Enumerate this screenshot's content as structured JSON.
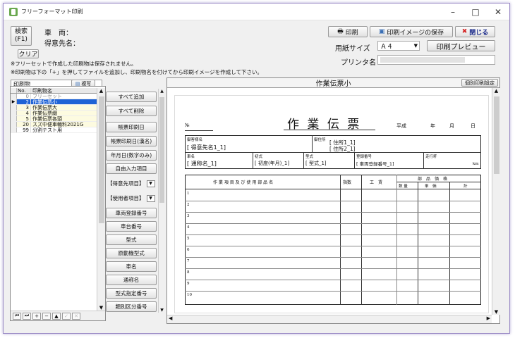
{
  "window": {
    "title": "フリーフォーマット印刷",
    "min": "–",
    "max": "□",
    "close": "✕"
  },
  "search": {
    "button": "検索\n(F1)",
    "vehicle_label": "車　両：",
    "client_label": "得意先名：",
    "clear": "クリア"
  },
  "toolbar": {
    "print": "印刷",
    "save_image": "印刷イメージの保存",
    "close": "閉じる",
    "paper_label": "用紙サイズ",
    "paper_value": "Ａ４",
    "preview": "印刷プレビュー",
    "printer_label": "プリンタ名"
  },
  "notes": [
    "※フリーセットで作成した印刷物は保存されません。",
    "※印刷物は下の「+」を押してファイルを追加し、印刷物名を付けてから印刷イメージを作成して下さい。"
  ],
  "list": {
    "title": "印刷物",
    "copy": "複写",
    "col_no": "No.",
    "col_name": "印刷物名",
    "rows": [
      {
        "no": "0",
        "name": "フリーセット"
      },
      {
        "no": "2",
        "name": "作業伝票小"
      },
      {
        "no": "3",
        "name": "作業伝票大"
      },
      {
        "no": "4",
        "name": "作業伝票綴"
      },
      {
        "no": "5",
        "name": "作業伝票各頭"
      },
      {
        "no": "20",
        "name": "スズ中便車輛料2021G"
      },
      {
        "no": "99",
        "name": "分割テスト用"
      }
    ]
  },
  "side": {
    "add_all": "すべて追加",
    "del_all": "すべて削除",
    "print_date": "帳票印刷日",
    "print_date_w": "帳票印刷日(漢名)",
    "ym": "年月日(数字のみ)",
    "free": "自由入力項目",
    "client_items": "【得意先項目】",
    "user_items": "【使用者項目】",
    "reg_no": "車両登録番号",
    "chassis": "車台番号",
    "model": "型式",
    "engine": "原動機型式",
    "car_name": "車名",
    "common_name": "通称名",
    "model_code": "型式指定番号",
    "class_no": "類別区分番号"
  },
  "preview": {
    "title": "作業伝票小",
    "settings": "個別印刷設定"
  },
  "form": {
    "no": "№",
    "title": "作 業 伝 票",
    "era": "平成",
    "y": "年",
    "m": "月",
    "d": "日",
    "client_label": "御客様名",
    "client_val": "[ 得意先名1_1]",
    "addr_label": "御住所",
    "addr1": "[ 住所1_1]",
    "addr2": "[ 住所2_1]",
    "car_label": "車名",
    "car_val": "[ 通称名_1]",
    "first_label": "初式",
    "first_val": "[ 初度(年月)_1]",
    "model_label": "型式",
    "model_val": "[ 型式_1]",
    "reg_label": "登録番号",
    "reg_val": "[ 車両登録番号_1]",
    "km_label": "走行粁",
    "km_unit": "km",
    "col_item": "作 業 項 目 及 び 使 用 部 品 名",
    "col_qty": "指数",
    "col_work": "工　賃",
    "col_parts": "部　品　価　格",
    "col_count": "数 量",
    "col_unit": "単　価",
    "col_total": "計",
    "rows": [
      "1",
      "2",
      "3",
      "4",
      "5",
      "6",
      "7",
      "8",
      "9",
      "10"
    ]
  }
}
